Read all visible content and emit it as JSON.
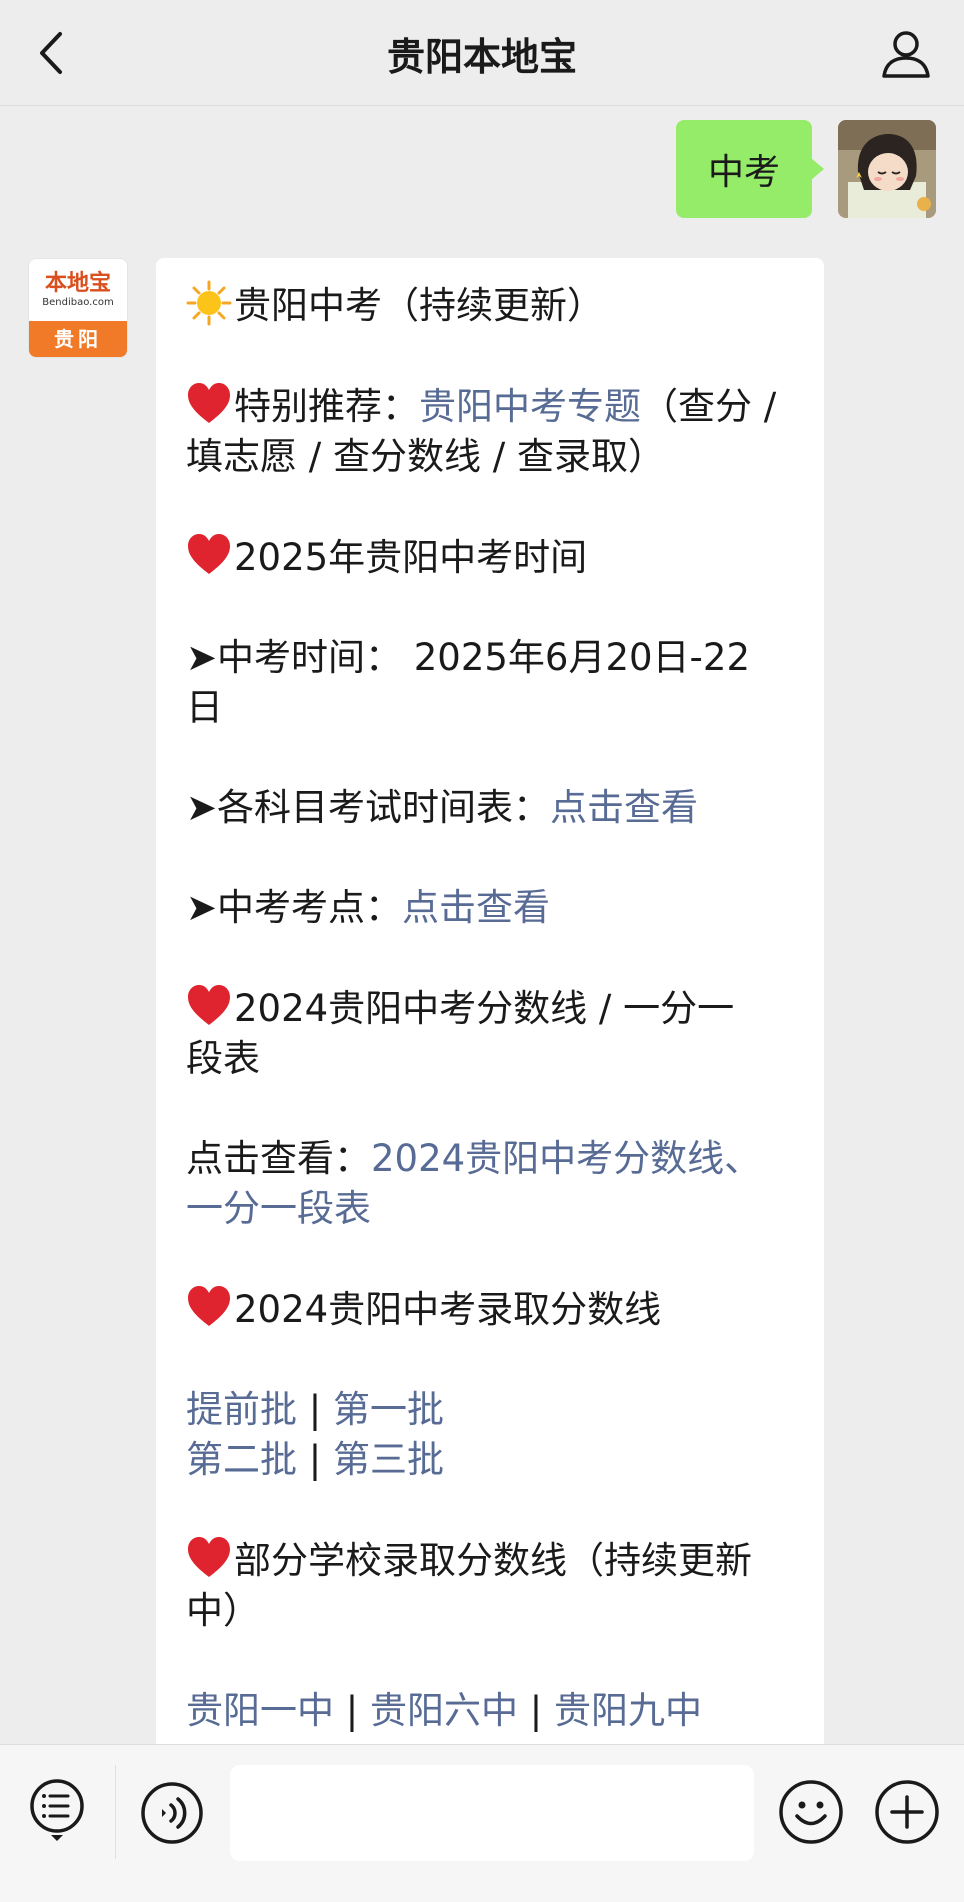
{
  "header": {
    "title": "贵阳本地宝",
    "back_icon": "chevron-left-icon",
    "profile_icon": "person-icon"
  },
  "outgoing": {
    "text": "中考"
  },
  "brand_avatar": {
    "top": "本地宝",
    "url": "Bendibao.com",
    "bottom": "贵阳"
  },
  "message": {
    "l1": "贵阳中考（持续更新）",
    "l2_prefix": "特别推荐：",
    "l2_link": "贵阳中考专题",
    "l2_suffix": "（查分 /",
    "l3": "填志愿 / 查分数线 / 查录取）",
    "l4": "2025年贵阳中考时间",
    "l5": "➤中考时间： 2025年6月20日-22",
    "l6": "日",
    "l7_prefix": "➤各科目考试时间表：",
    "l7_link": "点击查看",
    "l8_prefix": "➤中考考点：",
    "l8_link": "点击查看",
    "l9": "2024贵阳中考分数线 / 一分一",
    "l10": "段表",
    "l11_prefix": "点击查看：",
    "l11_link": "2024贵阳中考分数线、",
    "l12_link": "一分一段表",
    "l13": "2024贵阳中考录取分数线",
    "batch_1": "提前批",
    "batch_2": "第一批",
    "batch_3": "第二批",
    "batch_4": "第三批",
    "sep": " | ",
    "l16": "部分学校录取分数线（持续更新",
    "l17": "中）",
    "school_1": "贵阳一中",
    "school_2": "贵阳六中",
    "school_3": "贵阳九中"
  },
  "bottom_bar": {
    "menu_icon": "menu-list-icon",
    "voice_icon": "voice-icon",
    "input_value": "",
    "emoji_icon": "smiley-icon",
    "add_icon": "plus-icon"
  },
  "colors": {
    "link": "#576b95",
    "outgoing_bubble": "#95ec69",
    "background": "#ededed"
  }
}
